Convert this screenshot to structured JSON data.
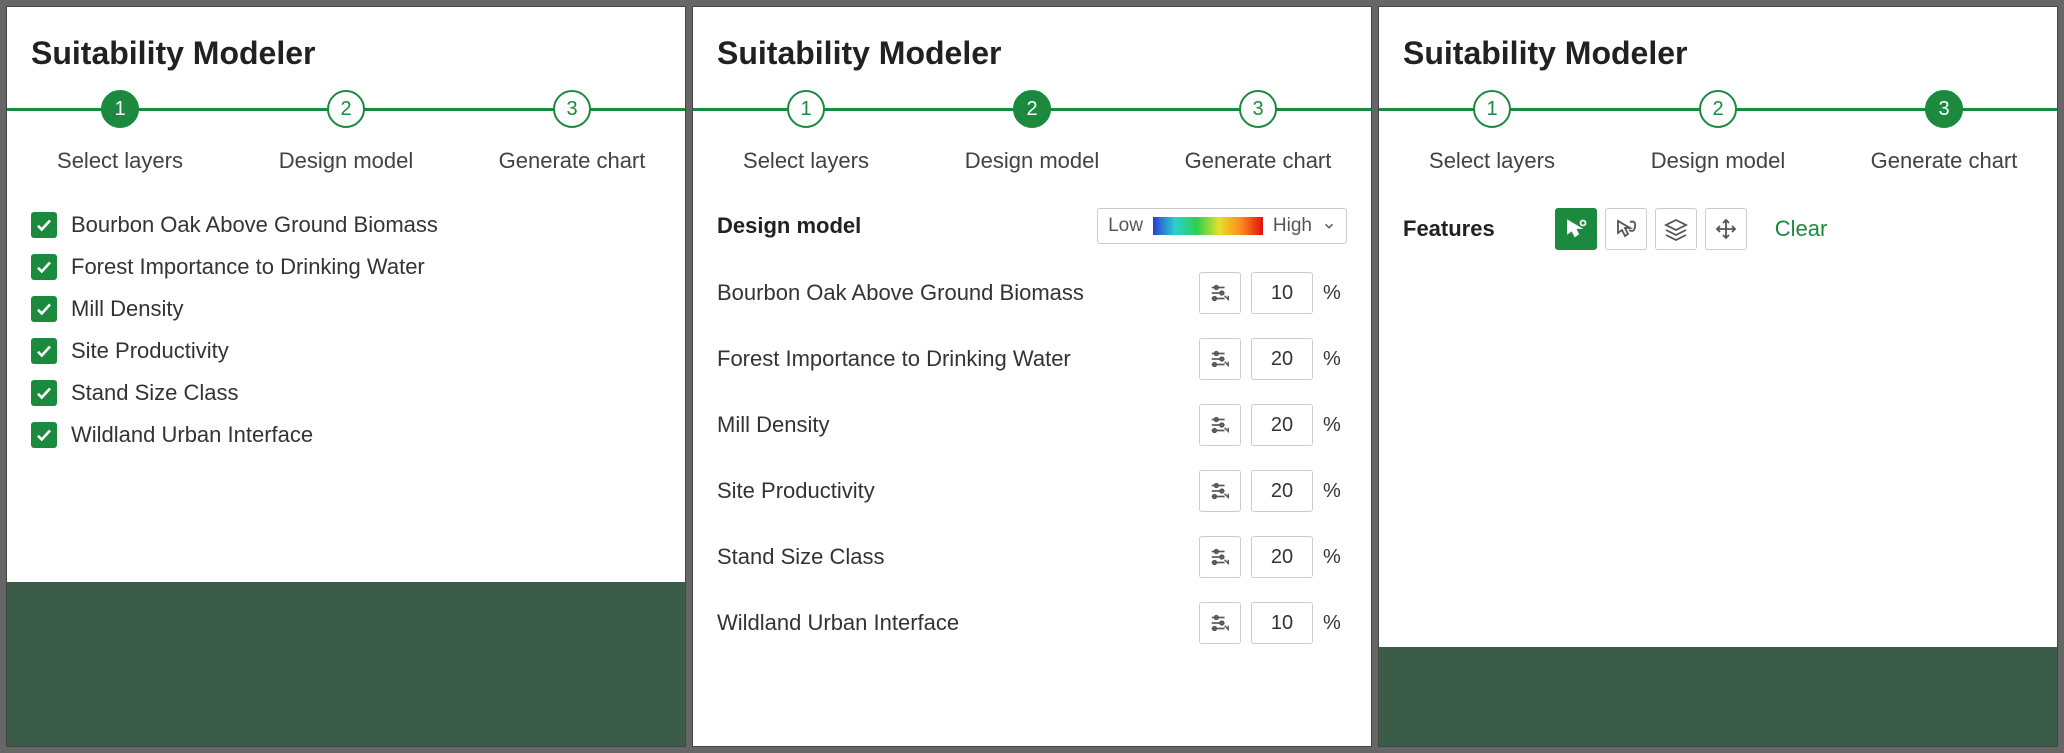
{
  "title": "Suitability Modeler",
  "steps": [
    {
      "num": "1",
      "label": "Select layers"
    },
    {
      "num": "2",
      "label": "Design model"
    },
    {
      "num": "3",
      "label": "Generate chart"
    }
  ],
  "panel1": {
    "layers": [
      "Bourbon Oak Above Ground Biomass",
      "Forest Importance to Drinking Water",
      "Mill Density",
      "Site Productivity",
      "Stand Size Class",
      "Wildland Urban Interface"
    ]
  },
  "panel2": {
    "heading": "Design model",
    "ramp_low": "Low",
    "ramp_high": "High",
    "pct_symbol": "%",
    "weights": [
      {
        "label": "Bourbon Oak Above Ground Biomass",
        "value": "10"
      },
      {
        "label": "Forest Importance to Drinking Water",
        "value": "20"
      },
      {
        "label": "Mill Density",
        "value": "20"
      },
      {
        "label": "Site Productivity",
        "value": "20"
      },
      {
        "label": "Stand Size Class",
        "value": "20"
      },
      {
        "label": "Wildland Urban Interface",
        "value": "10"
      }
    ]
  },
  "panel3": {
    "features_label": "Features",
    "clear": "Clear"
  },
  "colors": {
    "accent": "#1b8a3e"
  }
}
